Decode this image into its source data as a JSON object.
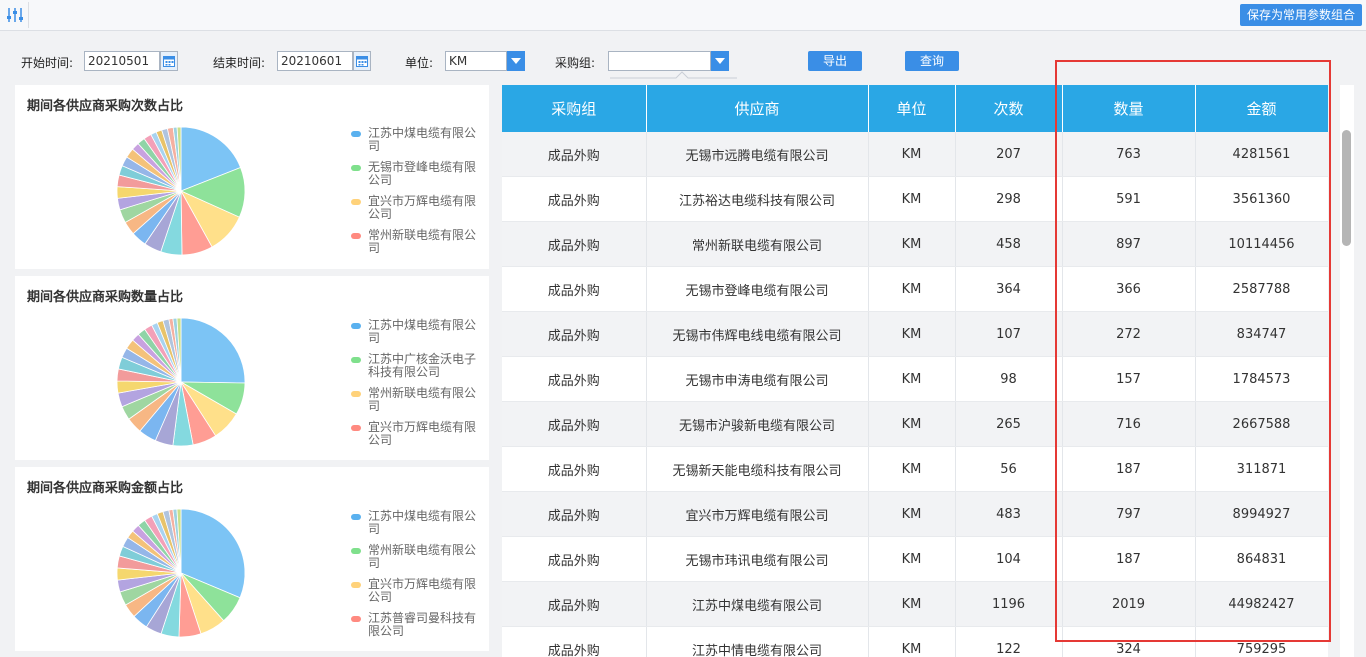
{
  "toolbar": {
    "save_label": "保存为常用参数组合"
  },
  "filters": {
    "start_label": "开始时间:",
    "start_value": "20210501",
    "end_label": "结束时间:",
    "end_value": "20210601",
    "unit_label": "单位:",
    "unit_value": "KM",
    "group_label": "采购组:",
    "group_value": "",
    "export_label": "导出",
    "query_label": "查询"
  },
  "colors": {
    "accent": "#3a8ee6",
    "header": "#2aa7e5",
    "highlight": "#e53935"
  },
  "chart_data": [
    {
      "type": "pie",
      "title": "期间各供应商采购次数占比",
      "legend": [
        {
          "name": "江苏中煤电缆有限公司",
          "color": "#5ab1ef"
        },
        {
          "name": "无锡市登峰电缆有限公司",
          "color": "#7fe08c"
        },
        {
          "name": "宜兴市万辉电缆有限公司",
          "color": "#ffd27a"
        },
        {
          "name": "常州新联电缆有限公司",
          "color": "#ff8a80"
        }
      ],
      "slices": [
        {
          "value": 19.5,
          "color": "#7cc4f5"
        },
        {
          "value": 13,
          "color": "#8ee29a"
        },
        {
          "value": 10.5,
          "color": "#ffe08a"
        },
        {
          "value": 8,
          "color": "#ff9d94"
        },
        {
          "value": 5.5,
          "color": "#84d9df"
        },
        {
          "value": 4.5,
          "color": "#a7a6d6"
        },
        {
          "value": 4,
          "color": "#7bb6f0"
        },
        {
          "value": 3.5,
          "color": "#f7b784"
        },
        {
          "value": 3.5,
          "color": "#9fd6a1"
        },
        {
          "value": 3,
          "color": "#b3a4e0"
        },
        {
          "value": 3,
          "color": "#f5d76e"
        },
        {
          "value": 3,
          "color": "#f29b9b"
        },
        {
          "value": 2.5,
          "color": "#7fcdd8"
        },
        {
          "value": 2.5,
          "color": "#95b6e8"
        },
        {
          "value": 2.5,
          "color": "#f4c27a"
        },
        {
          "value": 2,
          "color": "#c8a2e0"
        },
        {
          "value": 2,
          "color": "#8fd4a7"
        },
        {
          "value": 2,
          "color": "#f3a0b8"
        },
        {
          "value": 1.5,
          "color": "#a8d3f0"
        },
        {
          "value": 1.5,
          "color": "#e8c36a"
        },
        {
          "value": 1.5,
          "color": "#b0c4de"
        },
        {
          "value": 1.5,
          "color": "#f5b0a0"
        },
        {
          "value": 1,
          "color": "#9ed2e0"
        },
        {
          "value": 1,
          "color": "#c9e08a"
        }
      ]
    },
    {
      "type": "pie",
      "title": "期间各供应商采购数量占比",
      "legend": [
        {
          "name": "江苏中煤电缆有限公司",
          "color": "#5ab1ef"
        },
        {
          "name": "江苏中广核金沃电子科技有限公司",
          "color": "#7fe08c"
        },
        {
          "name": "常州新联电缆有限公司",
          "color": "#ffd27a"
        },
        {
          "name": "宜兴市万辉电缆有限公司",
          "color": "#ff8a80"
        }
      ],
      "slices": [
        {
          "value": 25,
          "color": "#7cc4f5"
        },
        {
          "value": 8,
          "color": "#8ee29a"
        },
        {
          "value": 7.5,
          "color": "#ffe08a"
        },
        {
          "value": 6,
          "color": "#ff9d94"
        },
        {
          "value": 5,
          "color": "#84d9df"
        },
        {
          "value": 4.5,
          "color": "#a7a6d6"
        },
        {
          "value": 4.5,
          "color": "#7bb6f0"
        },
        {
          "value": 4,
          "color": "#f7b784"
        },
        {
          "value": 3.5,
          "color": "#9fd6a1"
        },
        {
          "value": 3.5,
          "color": "#b3a4e0"
        },
        {
          "value": 3,
          "color": "#f5d76e"
        },
        {
          "value": 3,
          "color": "#f29b9b"
        },
        {
          "value": 3,
          "color": "#7fcdd8"
        },
        {
          "value": 2.5,
          "color": "#95b6e8"
        },
        {
          "value": 2.5,
          "color": "#f4c27a"
        },
        {
          "value": 2,
          "color": "#c8a2e0"
        },
        {
          "value": 2,
          "color": "#8fd4a7"
        },
        {
          "value": 2,
          "color": "#f3a0b8"
        },
        {
          "value": 1.5,
          "color": "#a8d3f0"
        },
        {
          "value": 1.5,
          "color": "#e8c36a"
        },
        {
          "value": 1.5,
          "color": "#b0c4de"
        },
        {
          "value": 1,
          "color": "#f5b0a0"
        },
        {
          "value": 1,
          "color": "#9ed2e0"
        },
        {
          "value": 1,
          "color": "#c9e08a"
        }
      ]
    },
    {
      "type": "pie",
      "title": "期间各供应商采购金额占比",
      "legend": [
        {
          "name": "江苏中煤电缆有限公司",
          "color": "#5ab1ef"
        },
        {
          "name": "常州新联电缆有限公司",
          "color": "#7fe08c"
        },
        {
          "name": "宜兴市万辉电缆有限公司",
          "color": "#ffd27a"
        },
        {
          "name": "江苏普睿司曼科技有限公司",
          "color": "#ff8a80"
        }
      ],
      "slices": [
        {
          "value": 31,
          "color": "#7cc4f5"
        },
        {
          "value": 7,
          "color": "#8ee29a"
        },
        {
          "value": 6.5,
          "color": "#ffe08a"
        },
        {
          "value": 5.5,
          "color": "#ff9d94"
        },
        {
          "value": 4.5,
          "color": "#84d9df"
        },
        {
          "value": 4,
          "color": "#a7a6d6"
        },
        {
          "value": 4,
          "color": "#7bb6f0"
        },
        {
          "value": 3.5,
          "color": "#f7b784"
        },
        {
          "value": 3.5,
          "color": "#9fd6a1"
        },
        {
          "value": 3,
          "color": "#b3a4e0"
        },
        {
          "value": 3,
          "color": "#f5d76e"
        },
        {
          "value": 3,
          "color": "#f29b9b"
        },
        {
          "value": 2.5,
          "color": "#7fcdd8"
        },
        {
          "value": 2.5,
          "color": "#95b6e8"
        },
        {
          "value": 2,
          "color": "#f4c27a"
        },
        {
          "value": 2,
          "color": "#c8a2e0"
        },
        {
          "value": 2,
          "color": "#8fd4a7"
        },
        {
          "value": 2,
          "color": "#f3a0b8"
        },
        {
          "value": 1.5,
          "color": "#a8d3f0"
        },
        {
          "value": 1.5,
          "color": "#e8c36a"
        },
        {
          "value": 1.5,
          "color": "#b0c4de"
        },
        {
          "value": 1,
          "color": "#f5b0a0"
        },
        {
          "value": 1,
          "color": "#9ed2e0"
        },
        {
          "value": 1,
          "color": "#c9e08a"
        }
      ]
    }
  ],
  "table": {
    "headers": [
      "采购组",
      "供应商",
      "单位",
      "次数",
      "数量",
      "金额"
    ],
    "rows": [
      [
        "成品外购",
        "无锡市远腾电缆有限公司",
        "KM",
        "207",
        "763",
        "4281561"
      ],
      [
        "成品外购",
        "江苏裕达电缆科技有限公司",
        "KM",
        "298",
        "591",
        "3561360"
      ],
      [
        "成品外购",
        "常州新联电缆有限公司",
        "KM",
        "458",
        "897",
        "10114456"
      ],
      [
        "成品外购",
        "无锡市登峰电缆有限公司",
        "KM",
        "364",
        "366",
        "2587788"
      ],
      [
        "成品外购",
        "无锡市伟辉电线电缆有限公司",
        "KM",
        "107",
        "272",
        "834747"
      ],
      [
        "成品外购",
        "无锡市申涛电缆有限公司",
        "KM",
        "98",
        "157",
        "1784573"
      ],
      [
        "成品外购",
        "无锡市沪骏新电缆有限公司",
        "KM",
        "265",
        "716",
        "2667588"
      ],
      [
        "成品外购",
        "无锡新天能电缆科技有限公司",
        "KM",
        "56",
        "187",
        "311871"
      ],
      [
        "成品外购",
        "宜兴市万辉电缆有限公司",
        "KM",
        "483",
        "797",
        "8994927"
      ],
      [
        "成品外购",
        "无锡市玮讯电缆有限公司",
        "KM",
        "104",
        "187",
        "864831"
      ],
      [
        "成品外购",
        "江苏中煤电缆有限公司",
        "KM",
        "1196",
        "2019",
        "44982427"
      ],
      [
        "成品外购",
        "江苏中情电缆有限公司",
        "KM",
        "122",
        "324",
        "759295"
      ]
    ]
  }
}
